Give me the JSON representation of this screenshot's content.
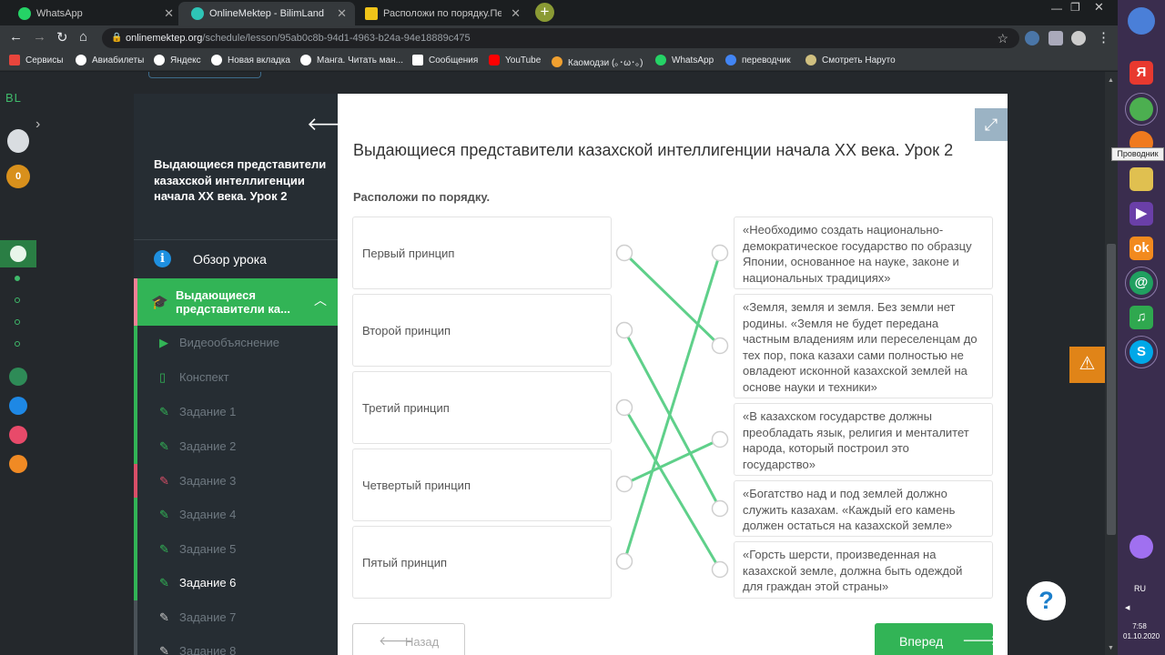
{
  "browser": {
    "tabs": [
      {
        "title": "WhatsApp",
        "icon": "whatsapp-icon",
        "color": "#25d366"
      },
      {
        "title": "OnlineMektep - BilimLand",
        "icon": "bilimland-icon",
        "color": "#2ec4b6"
      },
      {
        "title": "Расположи по порядку.Первый",
        "icon": "three-icon",
        "color": "#f0c419"
      }
    ],
    "url_domain": "onlinemektep.org",
    "url_path": "/schedule/lesson/95ab0c8b-94d1-4963-b24a-94e18889c475",
    "bookmarks": [
      {
        "label": "Сервисы",
        "color": "#e8453c"
      },
      {
        "label": "Авиабилеты",
        "color": "#ffffff"
      },
      {
        "label": "Яндекс",
        "color": "#ffffff"
      },
      {
        "label": "Новая вкладка",
        "color": "#ffffff"
      },
      {
        "label": "Манга. Читать ман...",
        "color": "#ffffff"
      },
      {
        "label": "Сообщения",
        "color": "#ffffff"
      },
      {
        "label": "YouTube",
        "color": "#ff0000"
      },
      {
        "label": "Каомодзи (｡･ω･｡)",
        "color": "#f0a030"
      },
      {
        "label": "WhatsApp",
        "color": "#25d366"
      },
      {
        "label": "переводчик",
        "color": "#4285f4"
      },
      {
        "label": "Смотреть Наруто",
        "color": "#d0c080"
      }
    ]
  },
  "rail": {
    "logo": "BL",
    "coins": "0"
  },
  "sidebar": {
    "lesson_title": "Выдающиеся представители казахской интеллигенции начала ХХ века. Урок 2",
    "overview": "Обзор урока",
    "section": "Выдающиеся представители ка...",
    "items": [
      {
        "label": "Видеообъяснение",
        "icon": "play-icon",
        "glyph": "▶",
        "state": "done"
      },
      {
        "label": "Конспект",
        "icon": "book-icon",
        "glyph": "▯",
        "state": "done"
      },
      {
        "label": "Задание 1",
        "icon": "edit-icon",
        "glyph": "✎",
        "state": "done"
      },
      {
        "label": "Задание 2",
        "icon": "edit-icon",
        "glyph": "✎",
        "state": "done"
      },
      {
        "label": "Задание 3",
        "icon": "edit-icon",
        "glyph": "✎",
        "state": "failed"
      },
      {
        "label": "Задание 4",
        "icon": "edit-icon",
        "glyph": "✎",
        "state": "done"
      },
      {
        "label": "Задание 5",
        "icon": "edit-icon",
        "glyph": "✎",
        "state": "done"
      },
      {
        "label": "Задание 6",
        "icon": "edit-icon",
        "glyph": "✎",
        "state": "current"
      },
      {
        "label": "Задание 7",
        "icon": "edit-icon",
        "glyph": "✎",
        "state": "pending"
      },
      {
        "label": "Задание 8",
        "icon": "edit-icon",
        "glyph": "✎",
        "state": "pending"
      }
    ]
  },
  "content": {
    "title": "Выдающиеся представители казахской интеллигенции начала ХХ века. Урок 2",
    "instruction": "Расположи по порядку.",
    "left": [
      "Первый принцип",
      "Второй принцип",
      "Третий принцип",
      "Четвертый принцип",
      "Пятый принцип"
    ],
    "right": [
      "«Необходимо создать национально-демократическое государство по образцу Японии, основанное на науке, законе и национальных традициях»",
      "«Земля, земля и земля. Без земли нет родины. «Земля не будет передана частным владениям или переселенцам до тех пор, пока казахи сами полностью не овладеют исконной казахской землей на основе науки и техники»",
      "«В казахском государстве должны преобладать язык, религия и менталитет народа, который построил это государство»",
      "«Богатство над и под землей должно служить казахам. «Каждый его камень должен остаться на казахской земле»",
      "«Горсть шерсти, произведенная на казахской земле, должна быть одеждой для граждан этой страны»"
    ],
    "matches": [
      1,
      3,
      4,
      2,
      0
    ],
    "line_color": "#5fd08a",
    "back": "Назад",
    "next": "Вперед"
  },
  "taskbar": {
    "tooltip": "Проводник",
    "lang": "RU",
    "time": "7:58",
    "date": "01.10.2020"
  }
}
